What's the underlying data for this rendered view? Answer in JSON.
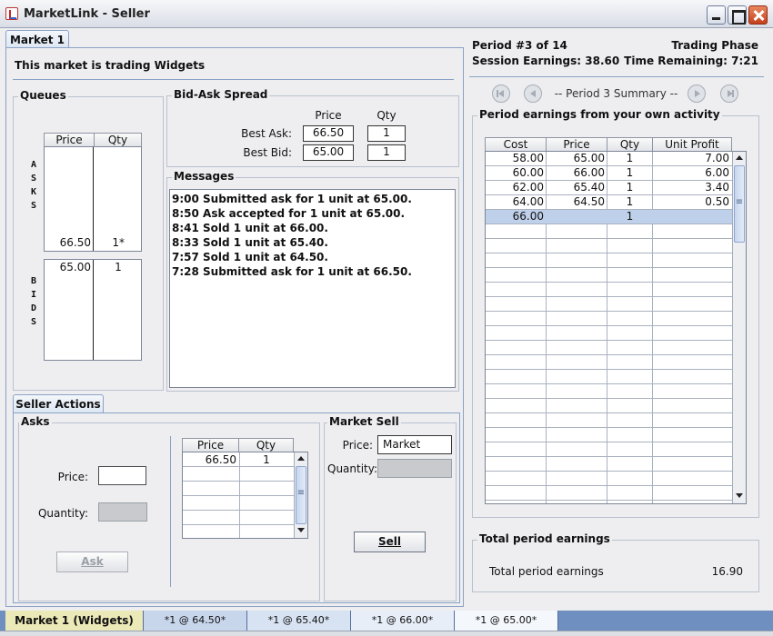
{
  "window": {
    "title": "MarketLink - Seller"
  },
  "market_tab": {
    "label": "Market 1"
  },
  "trading_banner": "This market is trading Widgets",
  "queues": {
    "title": "Queues",
    "headers": {
      "price": "Price",
      "qty": "Qty"
    },
    "asks_label": [
      "A",
      "S",
      "K",
      "S"
    ],
    "bids_label": [
      "B",
      "I",
      "D",
      "S"
    ],
    "asks": [
      {
        "price": "66.50",
        "qty": "1*"
      }
    ],
    "bids": [
      {
        "price": "65.00",
        "qty": "1"
      }
    ]
  },
  "spread": {
    "title": "Bid-Ask Spread",
    "price_header": "Price",
    "qty_header": "Qty",
    "best_ask_label": "Best Ask:",
    "best_ask_price": "66.50",
    "best_ask_qty": "1",
    "best_bid_label": "Best Bid:",
    "best_bid_price": "65.00",
    "best_bid_qty": "1"
  },
  "messages": {
    "title": "Messages",
    "lines": [
      "9:00 Submitted ask for 1 unit at 65.00.",
      "8:50 Ask accepted for 1 unit at 65.00.",
      "8:41 Sold 1 unit at 66.00.",
      "8:33 Sold 1 unit at 65.40.",
      "7:57 Sold 1 unit at 64.50.",
      "7:28 Submitted ask for 1 unit at 66.50."
    ]
  },
  "seller_actions": {
    "tab_label": "Seller Actions",
    "asks_title": "Asks",
    "price_label": "Price:",
    "price_value": "",
    "quantity_label": "Quantity:",
    "ask_button": "Ask",
    "table_headers": {
      "price": "Price",
      "qty": "Qty"
    },
    "table_rows": [
      {
        "price": "66.50",
        "qty": "1"
      }
    ],
    "market_sell_title": "Market Sell",
    "ms_price_label": "Price:",
    "ms_price_value": "Market",
    "ms_quantity_label": "Quantity:",
    "sell_button": "Sell"
  },
  "period_info": {
    "period": "Period #3 of 14",
    "phase": "Trading Phase",
    "session_earnings": "Session Earnings: 38.60",
    "time_remaining": "Time Remaining: 7:21",
    "summary_label": "-- Period 3 Summary --"
  },
  "period_earnings": {
    "title": "Period earnings from your own activity",
    "headers": {
      "cost": "Cost",
      "price": "Price",
      "qty": "Qty",
      "unit_profit": "Unit Profit"
    },
    "rows": [
      {
        "cost": "58.00",
        "price": "65.00",
        "qty": "1",
        "unit_profit": "7.00"
      },
      {
        "cost": "60.00",
        "price": "66.00",
        "qty": "1",
        "unit_profit": "6.00"
      },
      {
        "cost": "62.00",
        "price": "65.40",
        "qty": "1",
        "unit_profit": "3.40"
      },
      {
        "cost": "64.00",
        "price": "64.50",
        "qty": "1",
        "unit_profit": "0.50"
      },
      {
        "cost": "66.00",
        "price": "",
        "qty": "1",
        "unit_profit": ""
      }
    ]
  },
  "total_earnings": {
    "title": "Total period earnings",
    "label": "Total period earnings",
    "value": "16.90"
  },
  "status_bar": {
    "market": "Market 1 (Widgets)",
    "trades": [
      "*1 @ 64.50*",
      "*1 @ 65.40*",
      "*1 @ 66.00*",
      "*1 @ 65.00*"
    ]
  },
  "colors": {
    "selected_row": "#bfd0ea",
    "status_market_bg": "#ece9b8",
    "status_trade_bg": "#c8d6ec",
    "status_bar": "#6f8fc0"
  }
}
